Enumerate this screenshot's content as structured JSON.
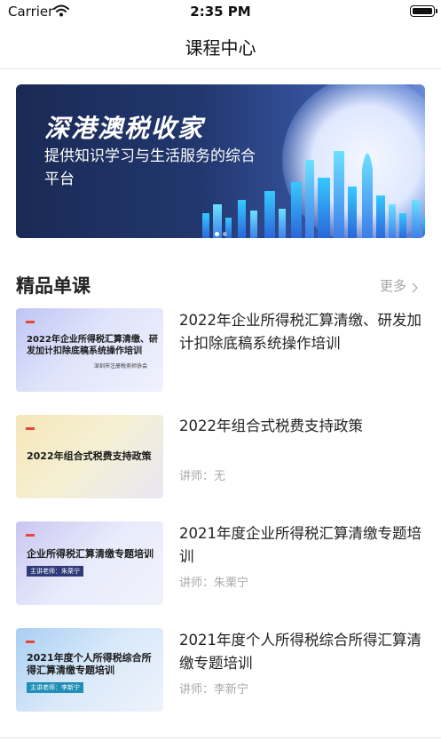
{
  "status_bar": {
    "carrier": "Carrier",
    "time": "2:35 PM"
  },
  "nav": {
    "title": "课程中心"
  },
  "banner": {
    "title": "深港澳税收家",
    "subtitle": "提供知识学习与生活服务的综合平台",
    "page_count": 2,
    "active_page": 1
  },
  "section": {
    "title": "精品单课",
    "more_label": "更多"
  },
  "courses": [
    {
      "title": "2022年企业所得税汇算清缴、研发加计扣除底稿系统操作培训",
      "teacher": "",
      "thumb_text": "2022年企业所得税汇算清缴、研发加计扣除底稿系统操作培训",
      "thumb_org": "深圳市注册税务师协会",
      "thumb_badge": ""
    },
    {
      "title": "2022年组合式税费支持政策",
      "teacher": "讲师：无",
      "thumb_text": "2022年组合式税费支持政策",
      "thumb_org": "",
      "thumb_badge": ""
    },
    {
      "title": "2021年度企业所得税汇算清缴专题培训",
      "teacher": "讲师：朱栗宁",
      "thumb_text": "企业所得税汇算清缴专题培训",
      "thumb_org": "",
      "thumb_badge": "主讲老师：朱栗宁"
    },
    {
      "title": "2021年度个人所得税综合所得汇算清缴专题培训",
      "teacher": "讲师：李新宁",
      "thumb_text": "2021年度个人所得税综合所得汇算清缴专题培训",
      "thumb_org": "",
      "thumb_badge": "主讲老师：李新宁"
    }
  ],
  "colors": {
    "accent_red": "#e3483a",
    "badge_navy": "#2f3a7a",
    "badge_teal": "#1f8fb5",
    "muted": "#a9a9a9"
  }
}
